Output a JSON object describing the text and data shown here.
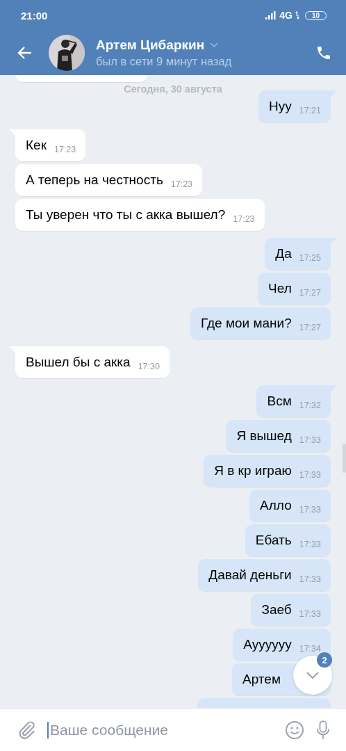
{
  "status_bar": {
    "time": "21:00",
    "network": "4G",
    "battery": "10"
  },
  "header": {
    "name": "Артем Цибаркин",
    "status": "был в сети 9 минут назад"
  },
  "date_label": "Сегодня, 30 августа",
  "messages": [
    {
      "kind": "outgoing",
      "tail": true,
      "text": "Нуу",
      "time": "17:21"
    },
    {
      "kind": "incoming",
      "tail": true,
      "text": "Кек",
      "time": "17:23"
    },
    {
      "kind": "incoming",
      "tail": false,
      "text": "А теперь на честность",
      "time": "17:23"
    },
    {
      "kind": "incoming",
      "tail": false,
      "text": "Ты уверен что ты с акка вышел?",
      "time": "17:23"
    },
    {
      "kind": "outgoing",
      "tail": true,
      "text": "Да",
      "time": "17:25"
    },
    {
      "kind": "outgoing",
      "tail": false,
      "text": "Чел",
      "time": "17:27"
    },
    {
      "kind": "outgoing",
      "tail": false,
      "text": "Где мои мани?",
      "time": "17:27"
    },
    {
      "kind": "incoming",
      "tail": true,
      "text": "Вышел бы с акка",
      "time": "17:30"
    },
    {
      "kind": "outgoing",
      "tail": true,
      "text": "Всм",
      "time": "17:32"
    },
    {
      "kind": "outgoing",
      "tail": false,
      "text": "Я вышед",
      "time": "17:33"
    },
    {
      "kind": "outgoing",
      "tail": false,
      "text": "Я в кр играю",
      "time": "17:33"
    },
    {
      "kind": "outgoing",
      "tail": false,
      "text": "Алло",
      "time": "17:33"
    },
    {
      "kind": "outgoing",
      "tail": false,
      "text": "Ебать",
      "time": "17:33"
    },
    {
      "kind": "outgoing",
      "tail": false,
      "text": "Давай деньги",
      "time": "17:33"
    },
    {
      "kind": "outgoing",
      "tail": false,
      "text": "Заеб",
      "time": "17:33"
    },
    {
      "kind": "outgoing",
      "tail": false,
      "text": "Ауууууу",
      "time": "17:34"
    },
    {
      "kind": "outgoing",
      "tail": false,
      "text": "Артем"
    }
  ],
  "scroll_down_button": {
    "badge": "2"
  },
  "composer": {
    "placeholder": "Ваше сообщение"
  }
}
